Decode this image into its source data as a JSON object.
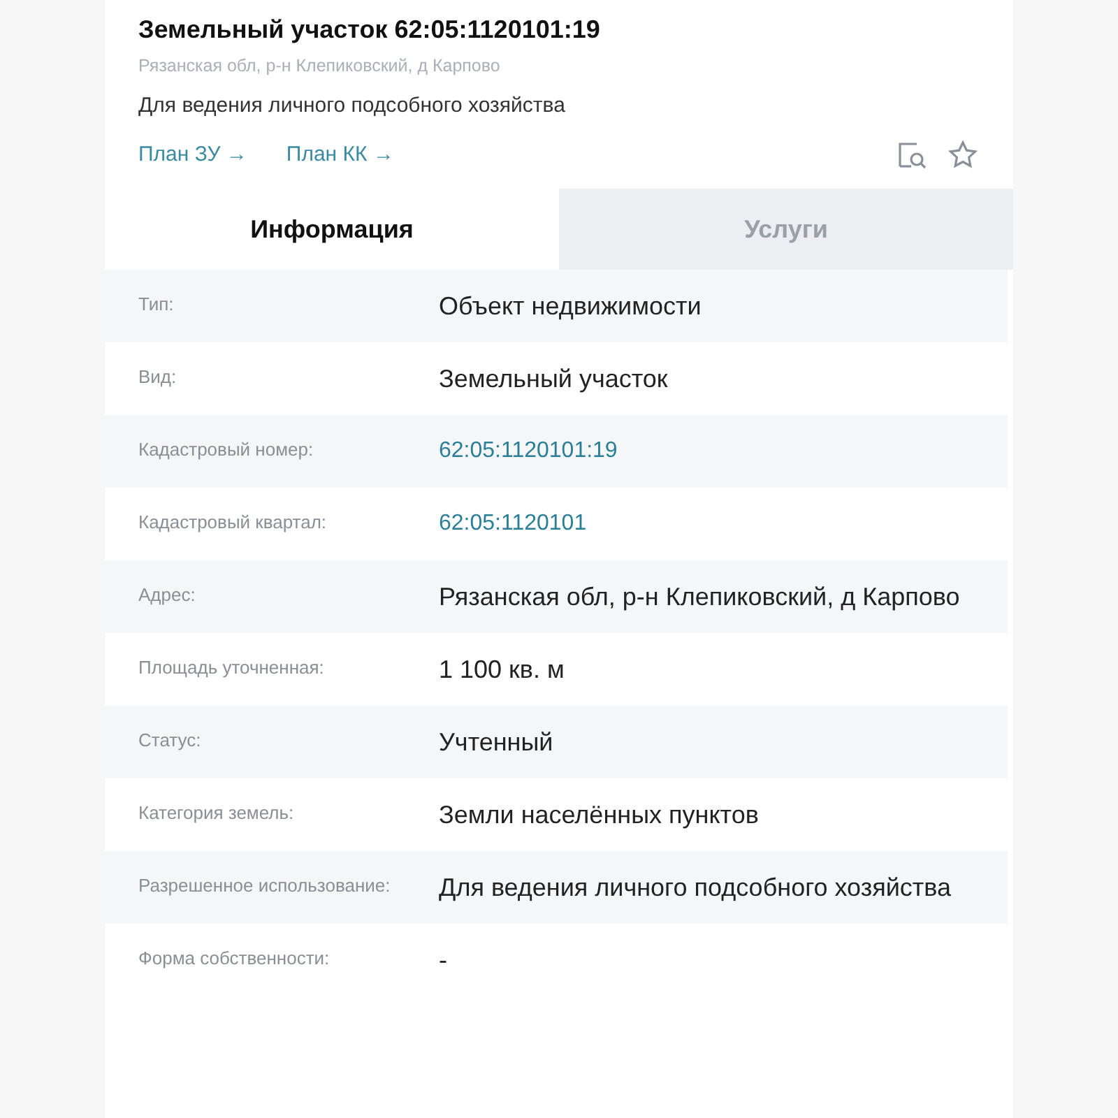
{
  "header": {
    "title": "Земельный участок 62:05:1120101:19",
    "address": "Рязанская обл, р-н Клепиковский, д Карпово",
    "purpose": "Для ведения личного подсобного хозяйства",
    "links": [
      "План ЗУ →",
      "План КК →"
    ]
  },
  "tabs": [
    {
      "label": "Информация",
      "selected": true
    },
    {
      "label": "Услуги",
      "selected": false
    }
  ],
  "rows": [
    {
      "label": "Тип:",
      "value": "Объект недвижимости",
      "kind": "text"
    },
    {
      "label": "Вид:",
      "value": "Земельный участок",
      "kind": "text"
    },
    {
      "label": "Кадастровый номер:",
      "value": "62:05:1120101:19",
      "kind": "link"
    },
    {
      "label": "Кадастровый квартал:",
      "value": "62:05:1120101",
      "kind": "link"
    },
    {
      "label": "Адрес:",
      "value": "Рязанская обл, р-н Клепиковский, д Карпово",
      "kind": "text"
    },
    {
      "label": "Площадь уточненная:",
      "value": "1 100 кв. м",
      "kind": "text"
    },
    {
      "label": "Статус:",
      "value": "Учтенный",
      "kind": "text"
    },
    {
      "label": "Категория земель:",
      "value": "Земли населённых пунктов",
      "kind": "text"
    },
    {
      "label": "Разрешенное использование:",
      "value": "Для ведения личного подсобного хозяйства",
      "kind": "text"
    },
    {
      "label": "Форма собственности:",
      "value": "-",
      "kind": "text"
    }
  ]
}
